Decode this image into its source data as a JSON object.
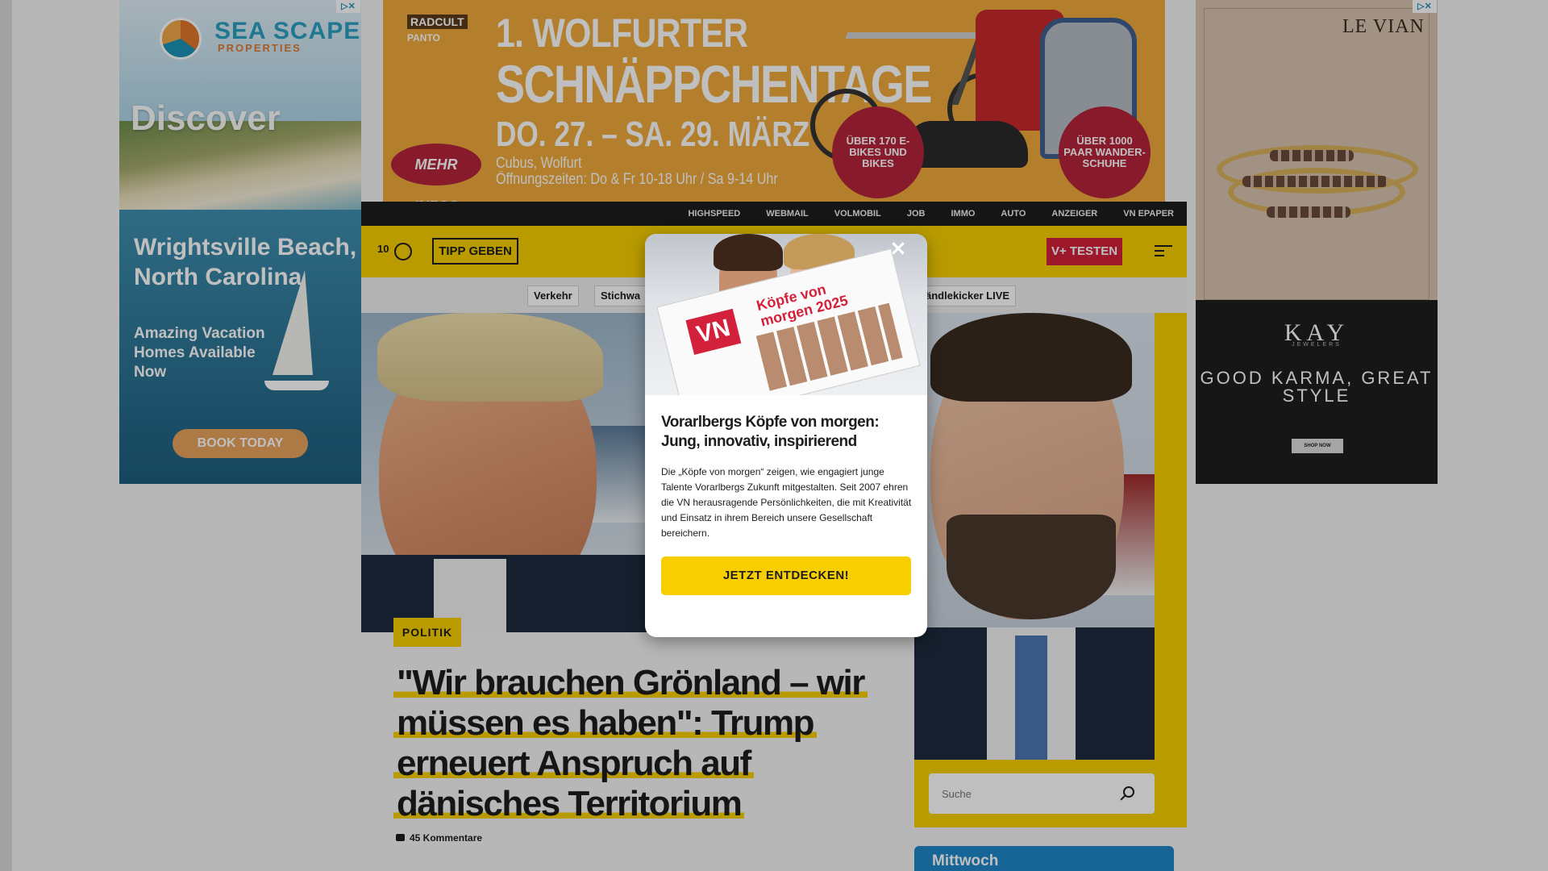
{
  "ads": {
    "left": {
      "brand": "SEA SCAPE",
      "brand_sub": "PROPERTIES",
      "headline": "Discover",
      "place": "Wrightsville Beach, North Carolina",
      "tagline": "Amazing Vacation Homes Available Now",
      "cta": "BOOK TODAY"
    },
    "top": {
      "logo1": "RADCULT",
      "logo2": "PANTO",
      "line1": "1. WOLFURTER",
      "line2": "SCHNÄPPCHENTAGE",
      "dates": "DO. 27. – SA. 29. MÄRZ",
      "location": "Cubus, Wolfurt",
      "hours": "Öffnungszeiten: Do & Fr 10-18 Uhr / Sa 9-14 Uhr",
      "more": "MEHR INFOS",
      "badge1": "ÜBER 170 E-BIKES UND BIKES",
      "badge2": "ÜBER 1000 PAAR WANDER-SCHUHE"
    },
    "right": {
      "brand_top": "LE VIAN",
      "brand": "KAY",
      "brand_sub": "JEWELERS",
      "slogan": "GOOD KARMA, GREAT STYLE",
      "cta": "SHOP NOW"
    }
  },
  "topnav": [
    "HIGHSPEED",
    "WEBMAIL",
    "VOLMOBIL",
    "JOB",
    "IMMO",
    "AUTO",
    "ANZEIGER",
    "VN EPAPER"
  ],
  "header": {
    "temperature": "10",
    "tip_button": "TIPP GEBEN",
    "trial_button": "V+ TESTEN"
  },
  "subnav": {
    "chip1": "Verkehr",
    "chip2": "Stichwa",
    "chip3": "ändlekicker LIVE"
  },
  "article": {
    "category": "POLITIK",
    "headline_lines": [
      "\"Wir brauchen Grönland – wir",
      "müssen es haben\": Trump",
      "erneuert Anspruch auf",
      "dänisches Territorium"
    ],
    "comments": "45 Kommentare"
  },
  "sidebar": {
    "search_placeholder": "Suche",
    "box_title": "Mittwoch"
  },
  "modal": {
    "title": "Vorarlbergs Köpfe von morgen: Jung, innovativ, inspirierend",
    "body": "Die „Köpfe von morgen“ zeigen, wie engagiert junge Talente Vorarlbergs Zukunft mitgestalten. Seit 2007 ehren die VN herausragende Persönlichkeiten, die mit Kreativität und Einsatz in ihrem Bereich unsere Gesellschaft bereichern.",
    "cta": "JETZT ENTDECKEN!",
    "close": "×",
    "paper_title": "Köpfe von morgen 2025",
    "paper_logo": "VN"
  },
  "colors": {
    "brand_yellow": "#f7cf00",
    "brand_red": "#d3213b",
    "dark": "#1d1d1d"
  }
}
